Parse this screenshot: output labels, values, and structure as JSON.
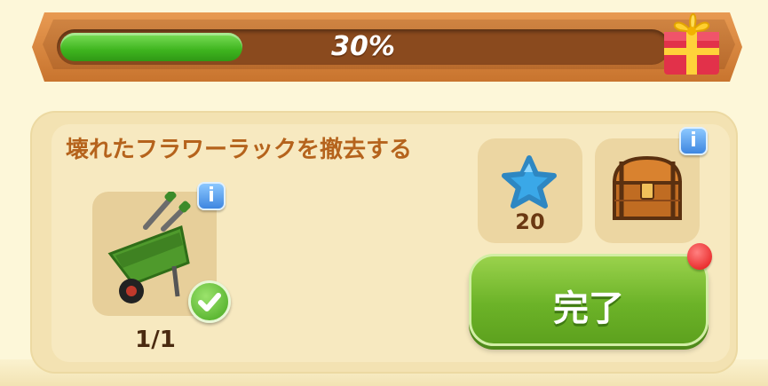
{
  "progress": {
    "percent_label": "30%",
    "value": 0.3
  },
  "task": {
    "title": "壊れたフラワーラックを撤去する",
    "required_item": {
      "icon": "wheelbarrow-icon",
      "count": "1/1",
      "completed": true,
      "info_label": "i"
    }
  },
  "rewards": [
    {
      "icon": "blue-star-icon",
      "amount": "20"
    },
    {
      "icon": "treasure-chest-icon",
      "info_label": "i"
    }
  ],
  "actions": {
    "complete_label": "完了"
  },
  "colors": {
    "title": "#b5631c",
    "button": "#6cb328",
    "progress_fill": "#3fb51f",
    "badge": "#e31212"
  }
}
